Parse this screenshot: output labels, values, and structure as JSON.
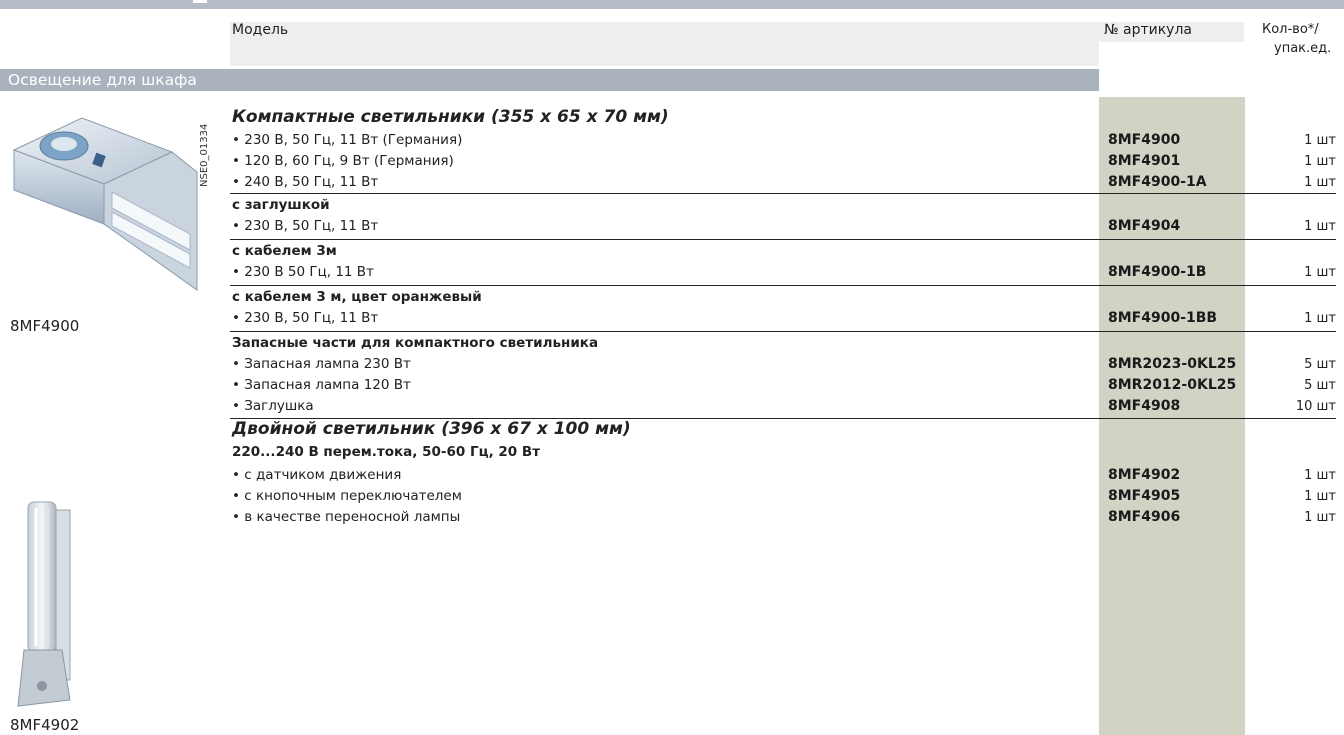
{
  "header": {
    "model": "Модель",
    "article": "№ артикула",
    "qty_line1": "Кол-во*/",
    "qty_line2": "упак.ед."
  },
  "section": {
    "title": "Освещение для шкафа"
  },
  "images": {
    "img1_caption": "8MF4900",
    "img1_code": "NSE0_01334",
    "img2_caption": "8MF4902"
  },
  "rows": [
    {
      "type": "group",
      "model": "Компактные светильники (355 x 65 x 70 мм)",
      "article": "",
      "qty": ""
    },
    {
      "type": "item",
      "model": "• 230 В, 50 Гц, 11 Вт (Германия)",
      "article": "8MF4900",
      "qty": "1 шт"
    },
    {
      "type": "item",
      "model": "• 120 В, 60 Гц, 9 Вт (Германия)",
      "article": "8MF4901",
      "qty": "1 шт"
    },
    {
      "type": "item",
      "model": "• 240 В, 50 Гц, 11 Вт",
      "article": "8MF4900-1A",
      "qty": "1 шт"
    },
    {
      "type": "sub",
      "model": "с заглушкой",
      "article": "",
      "qty": ""
    },
    {
      "type": "item",
      "model": "• 230 В, 50 Гц, 11 Вт",
      "article": "8MF4904",
      "qty": "1 шт"
    },
    {
      "type": "sub",
      "model": "с кабелем 3м",
      "article": "",
      "qty": ""
    },
    {
      "type": "item",
      "model": "• 230 В 50 Гц, 11 Вт",
      "article": "8MF4900-1B",
      "qty": "1 шт"
    },
    {
      "type": "sub",
      "model": "с кабелем 3 м, цвет оранжевый",
      "article": "",
      "qty": ""
    },
    {
      "type": "item",
      "model": "• 230 В, 50 Гц, 11 Вт",
      "article": "8MF4900-1BB",
      "qty": "1 шт"
    },
    {
      "type": "sub",
      "model": "Запасные части для компактного светильника",
      "article": "",
      "qty": ""
    },
    {
      "type": "item",
      "model": "• Запасная лампа 230 Вт",
      "article": "8MR2023-0KL25",
      "qty": "5 шт"
    },
    {
      "type": "item",
      "model": "• Запасная лампа 120 Вт",
      "article": "8MR2012-0KL25",
      "qty": "5 шт"
    },
    {
      "type": "item",
      "model": "• Заглушка",
      "article": "8MF4908",
      "qty": "10 шт"
    },
    {
      "type": "group",
      "model": "Двойной светильник (396 x 67 x 100  мм)",
      "article": "",
      "qty": ""
    },
    {
      "type": "sub",
      "model": "220...240 В перем.тока, 50-60 Гц, 20 Вт",
      "article": "",
      "qty": ""
    },
    {
      "type": "item",
      "model": "• с датчиком движения",
      "article": "8MF4902",
      "qty": "1 шт"
    },
    {
      "type": "item",
      "model": "• с кнопочным переключателем",
      "article": "8MF4905",
      "qty": "1 шт"
    },
    {
      "type": "item",
      "model": "• в качестве переносной лампы",
      "article": "8MF4906",
      "qty": "1 шт"
    }
  ]
}
